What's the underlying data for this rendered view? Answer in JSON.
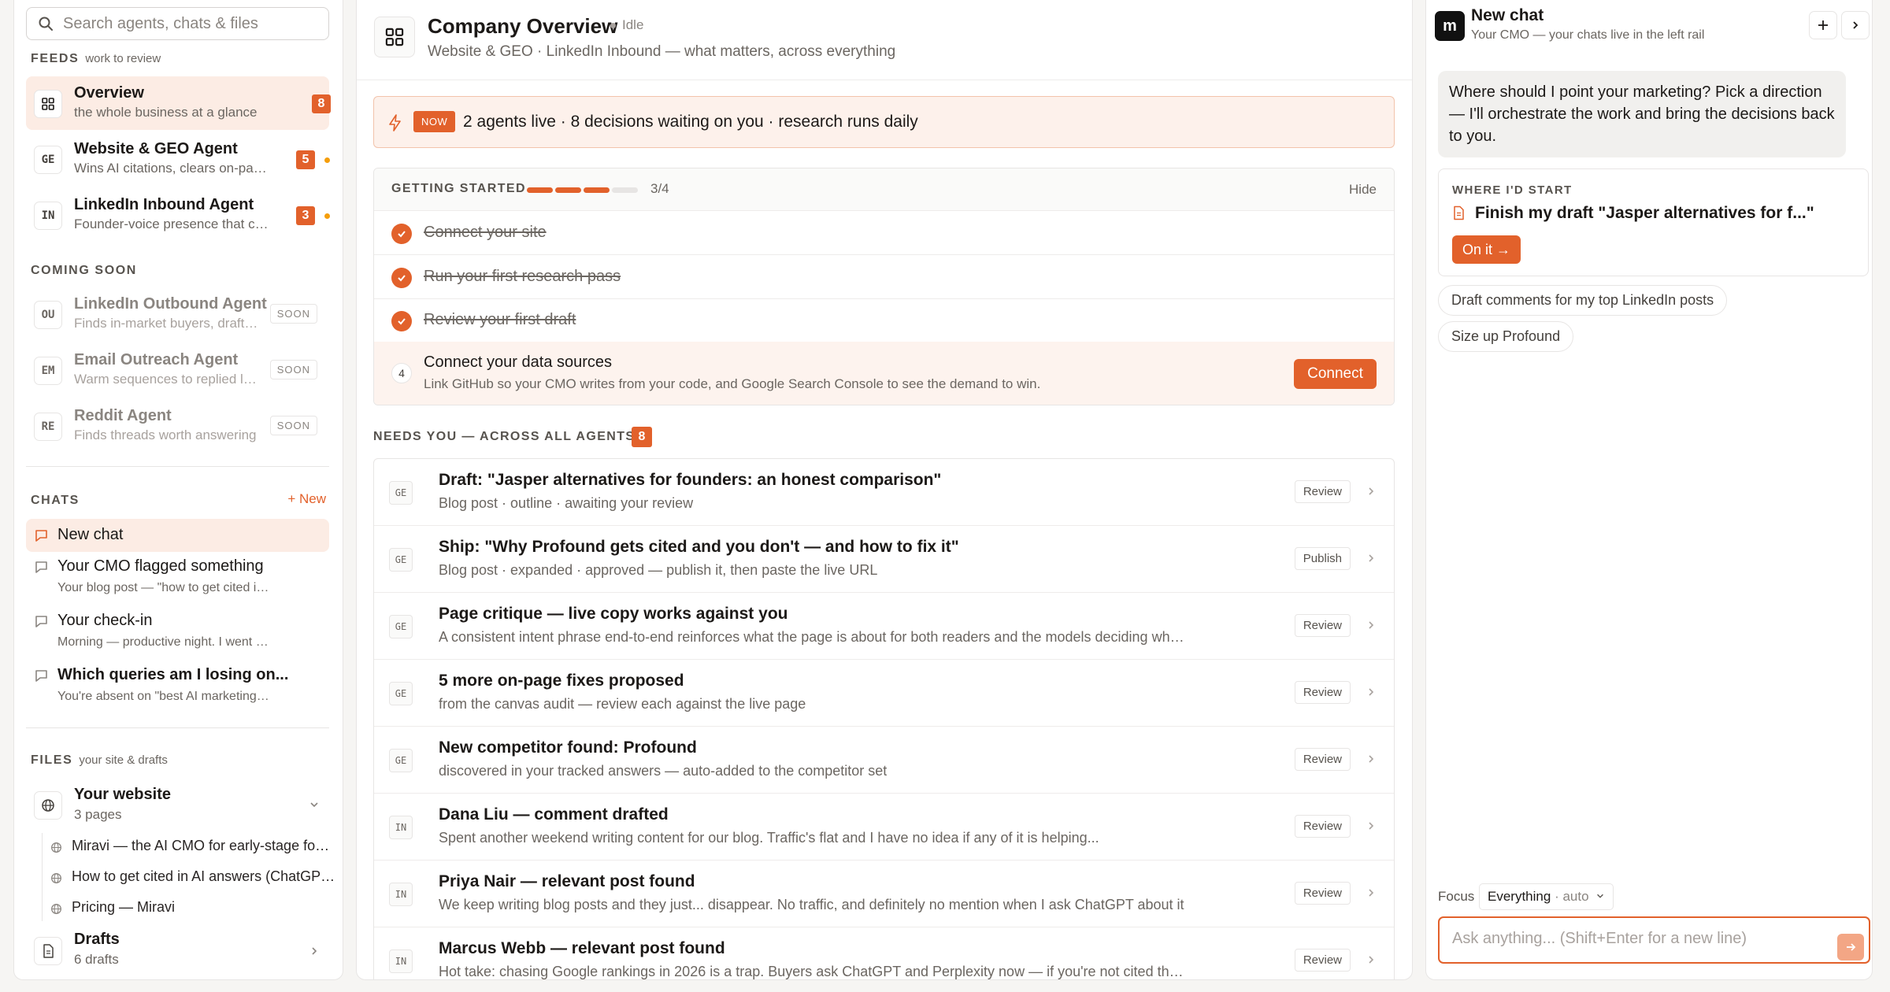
{
  "search": {
    "placeholder": "Search agents, chats & files"
  },
  "feeds": {
    "label": "FEEDS",
    "sub": "work to review",
    "items": [
      {
        "avatar": "",
        "name": "Overview",
        "desc": "the whole business at a glance",
        "count": "8"
      },
      {
        "avatar": "GE",
        "name": "Website & GEO Agent",
        "desc": "Wins AI citations, clears on-page fixes",
        "count": "5"
      },
      {
        "avatar": "IN",
        "name": "LinkedIn Inbound Agent",
        "desc": "Founder-voice presence that converts",
        "count": "3"
      }
    ]
  },
  "coming_soon": {
    "label": "COMING SOON",
    "soon_tag": "SOON",
    "items": [
      {
        "avatar": "OU",
        "name": "LinkedIn Outbound Agent",
        "desc": "Finds in-market buyers, drafts outreach"
      },
      {
        "avatar": "EM",
        "name": "Email Outreach Agent",
        "desc": "Warm sequences to replied leads"
      },
      {
        "avatar": "RE",
        "name": "Reddit Agent",
        "desc": "Finds threads worth answering"
      }
    ]
  },
  "chats": {
    "label": "CHATS",
    "new_label": "+ New",
    "items": [
      {
        "title": "New chat",
        "snippet": ""
      },
      {
        "title": "Your CMO flagged something",
        "snippet": "Your blog post — \"how to get cited in AI answers\""
      },
      {
        "title": "Your check-in",
        "snippet": "Morning — productive night. I went through everything"
      },
      {
        "title": "Which queries am I losing on...",
        "snippet": "You're absent on \"best AI marketing tools\""
      }
    ]
  },
  "files": {
    "label": "FILES",
    "sub": "your site & drafts",
    "website": {
      "title": "Your website",
      "sub": "3 pages"
    },
    "pages": [
      "Miravi — the AI CMO for early-stage founders",
      "How to get cited in AI answers (ChatGPT, Perplexity)",
      "Pricing — Miravi"
    ],
    "drafts": {
      "title": "Drafts",
      "sub": "6 drafts"
    }
  },
  "header": {
    "title": "Company Overview",
    "status": "Idle",
    "subtitle": "Website & GEO · LinkedIn Inbound — what matters, across everything"
  },
  "now": {
    "tag": "NOW",
    "text": "2 agents live · 8 decisions waiting on you · research runs daily"
  },
  "getting_started": {
    "label": "GETTING STARTED",
    "progress_done": 3,
    "progress_total": 4,
    "count_text": "3/4",
    "hide_label": "Hide",
    "done_steps": [
      "Connect your site",
      "Run your first research pass",
      "Review your first draft"
    ],
    "current": {
      "number": "4",
      "title": "Connect your data sources",
      "desc": "Link GitHub so your CMO writes from your code, and Google Search Console to see the demand to win.",
      "button": "Connect"
    }
  },
  "needs": {
    "label": "NEEDS YOU — ACROSS ALL AGENTS",
    "count": "8",
    "rows": [
      {
        "tag": "GE",
        "title": "Draft: \"Jasper alternatives for founders: an honest comparison\"",
        "desc": "Blog post · outline · awaiting your review",
        "action": "Review"
      },
      {
        "tag": "GE",
        "title": "Ship: \"Why Profound gets cited and you don't — and how to fix it\"",
        "desc": "Blog post · expanded · approved — publish it, then paste the live URL",
        "action": "Publish"
      },
      {
        "tag": "GE",
        "title": "Page critique — live copy works against you",
        "desc": "A consistent intent phrase end-to-end reinforces what the page is about for both readers and the models deciding what to cite",
        "action": "Review"
      },
      {
        "tag": "GE",
        "title": "5 more on-page fixes proposed",
        "desc": "from the canvas audit — review each against the live page",
        "action": "Review"
      },
      {
        "tag": "GE",
        "title": "New competitor found: Profound",
        "desc": "discovered in your tracked answers — auto-added to the competitor set",
        "action": "Review"
      },
      {
        "tag": "IN",
        "title": "Dana Liu — comment drafted",
        "desc": "Spent another weekend writing content for our blog. Traffic's flat and I have no idea if any of it is helping...",
        "action": "Review"
      },
      {
        "tag": "IN",
        "title": "Priya Nair — relevant post found",
        "desc": "We keep writing blog posts and they just... disappear. No traffic, and definitely no mention when I ask ChatGPT about it",
        "action": "Review"
      },
      {
        "tag": "IN",
        "title": "Marcus Webb — relevant post found",
        "desc": "Hot take: chasing Google rankings in 2026 is a trap. Buyers ask ChatGPT and Perplexity now — if you're not cited there",
        "action": "Review"
      }
    ]
  },
  "right": {
    "logo": "m",
    "title": "New chat",
    "subtitle": "Your CMO — your chats live in the left rail",
    "message": "Where should I point your marketing? Pick a direction — I'll orchestrate the work and bring the decisions back to you.",
    "start_label": "WHERE I'D START",
    "start_title": "Finish my draft \"Jasper alternatives for f...\"",
    "start_button": "On it →",
    "chips": [
      "Draft comments for my top LinkedIn posts",
      "Size up Profound"
    ],
    "focus_label": "Focus",
    "focus_value": "Everything",
    "focus_mode": "· auto",
    "input_placeholder": "Ask anything...  (Shift+Enter for a new line)"
  },
  "colors": {
    "accent": "#e2612b",
    "accent_bg": "#fcece4",
    "badge_dot": "#f59e0b"
  }
}
